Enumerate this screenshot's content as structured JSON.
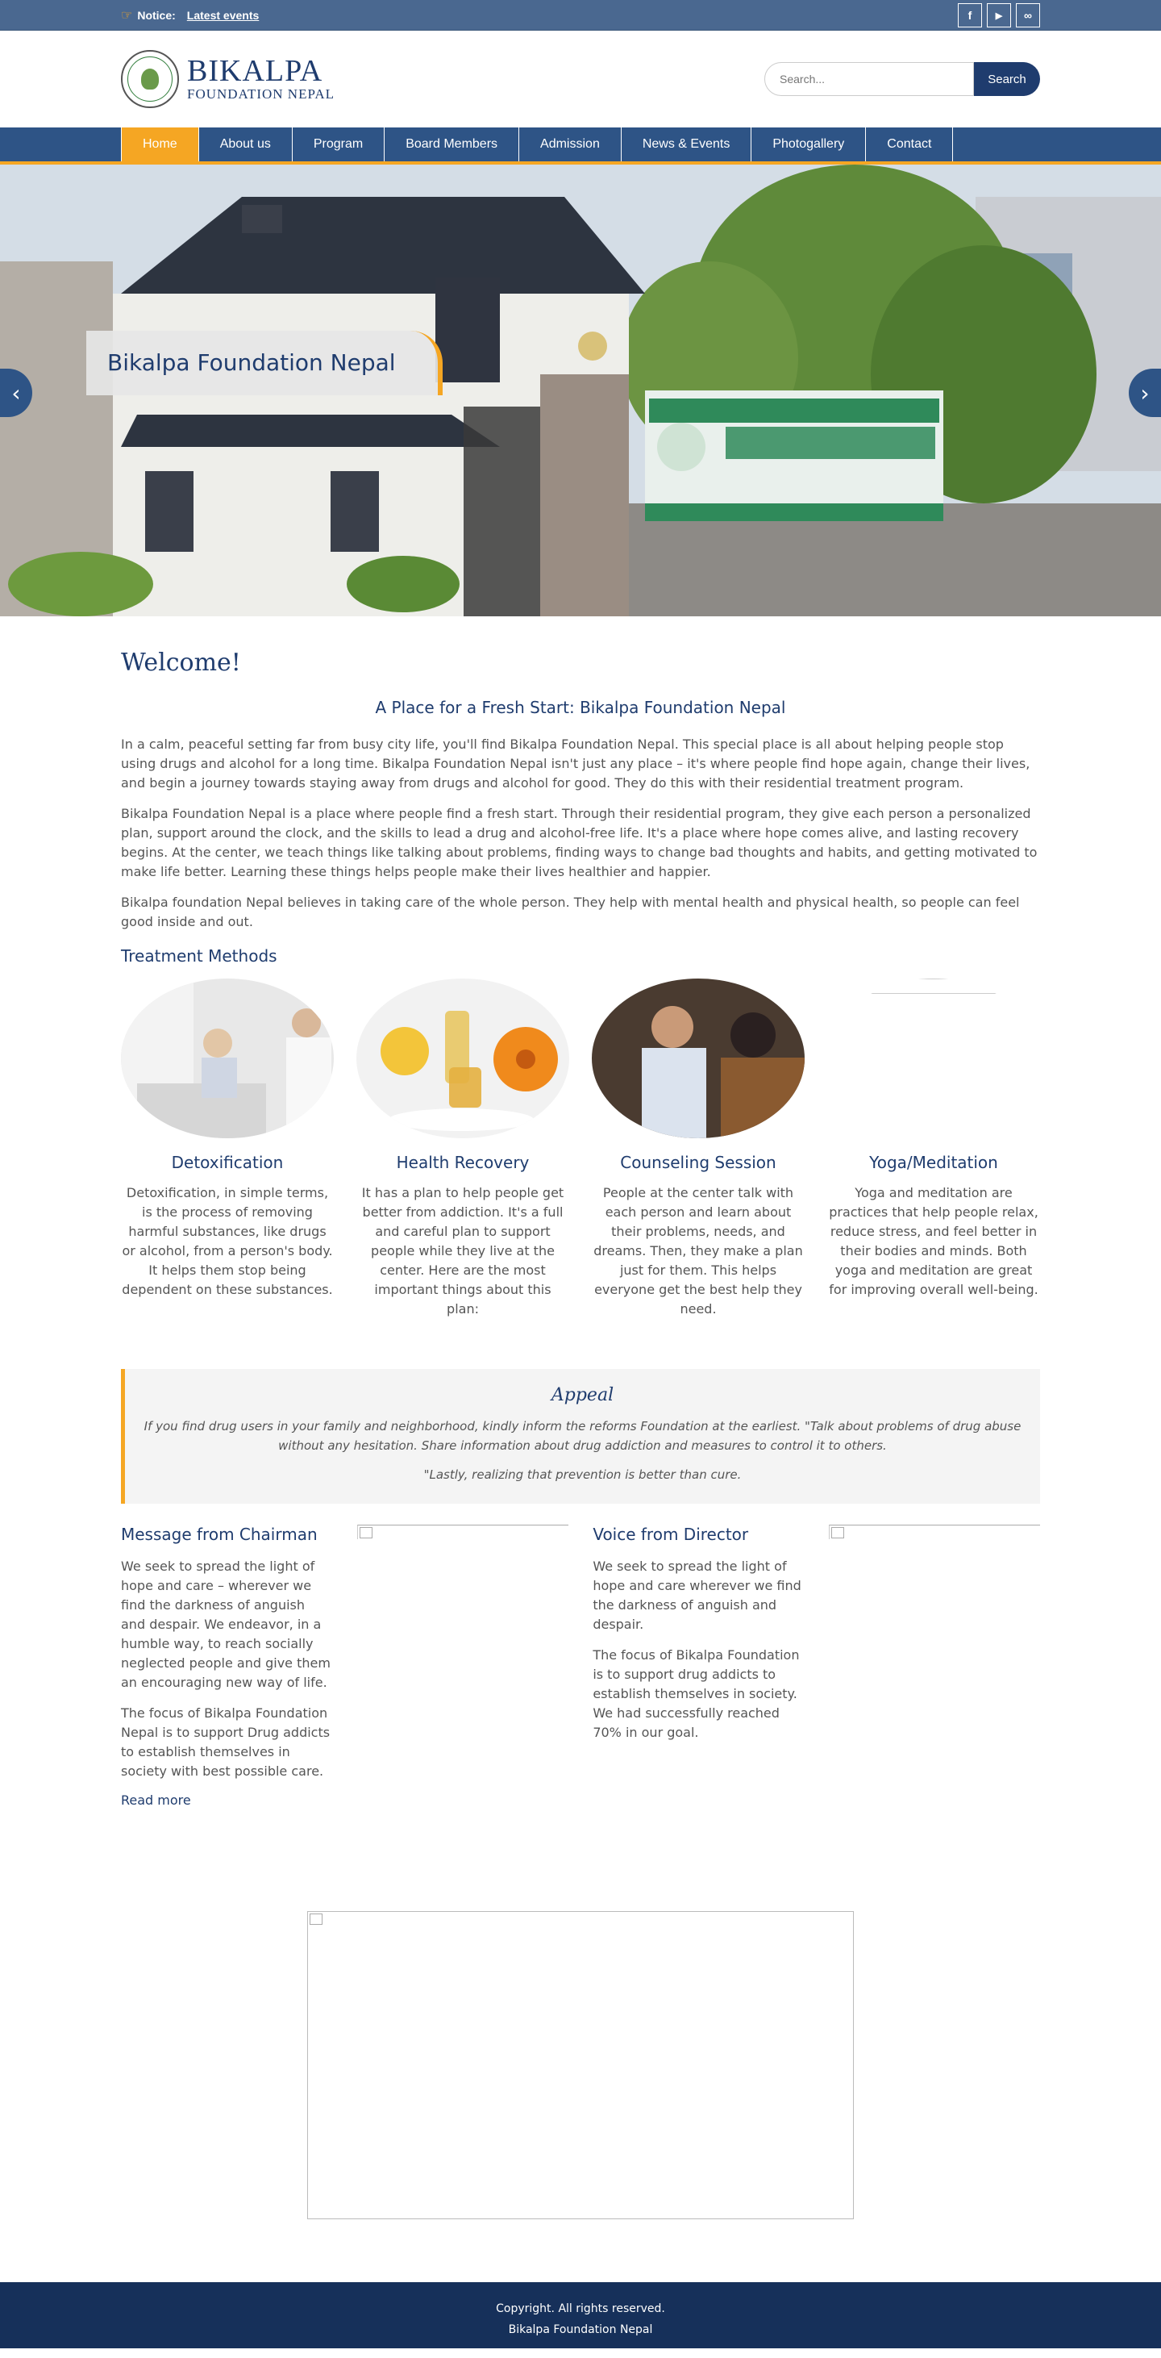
{
  "topbar": {
    "notice_label": "Notice:",
    "notice_link": "Latest events",
    "socials": [
      {
        "icon": "facebook-icon",
        "glyph": "f"
      },
      {
        "icon": "youtube-icon",
        "glyph": "▶"
      },
      {
        "icon": "link-icon",
        "glyph": "∞"
      }
    ]
  },
  "header": {
    "brand_line1": "BIKALPA",
    "brand_line2": "FOUNDATION NEPAL",
    "search_placeholder": "Search...",
    "search_button": "Search"
  },
  "nav": {
    "items": [
      "Home",
      "About us",
      "Program",
      "Board Members",
      "Admission",
      "News & Events",
      "Photogallery",
      "Contact"
    ],
    "active": "Home"
  },
  "hero": {
    "caption": "Bikalpa Foundation Nepal"
  },
  "welcome": {
    "title": "Welcome!",
    "subtitle": "A Place for a Fresh Start: Bikalpa Foundation Nepal",
    "paragraphs": [
      "In a calm, peaceful setting far from busy city life, you'll find Bikalpa Foundation Nepal. This special place is all about helping people stop using drugs and alcohol for a long time. Bikalpa Foundation Nepal isn't just any place – it's where people find hope again, change their lives, and begin a journey towards staying away from drugs and alcohol for good. They do this with their residential treatment program.",
      "Bikalpa Foundation Nepal is a place where people find a fresh start. Through their residential program, they give each person a personalized plan, support around the clock, and the skills to lead a drug and alcohol-free life. It's a place where hope comes alive, and lasting recovery begins. At the center, we teach things like talking about problems, finding ways to change bad thoughts and habits, and getting motivated to make life better. Learning these things helps people make their lives healthier and happier.",
      "Bikalpa foundation Nepal believes in taking care of the whole person. They help with mental health and physical health, so people can feel good inside and out."
    ]
  },
  "treatment": {
    "heading": "Treatment Methods",
    "methods": [
      {
        "title": "Detoxification",
        "text": "Detoxification, in simple terms, is the process of removing harmful substances, like drugs or alcohol, from a person's body. It helps them stop being dependent on these substances."
      },
      {
        "title": "Health Recovery",
        "text": "It has a plan to help people get better from addiction. It's a full and careful plan to support people while they live at the center. Here are the most important things about this plan:"
      },
      {
        "title": "Counseling Session",
        "text": "People at the center talk with each person and learn about their problems, needs, and dreams. Then, they make a plan just for them. This helps everyone get the best help they need."
      },
      {
        "title": "Yoga/Meditation",
        "text": "Yoga and meditation are practices that help people relax, reduce stress, and feel better in their bodies and minds. Both yoga and meditation are great for improving overall well-being."
      }
    ]
  },
  "appeal": {
    "title": "Appeal",
    "text1": "If you find drug users in your family and neighborhood, kindly inform the reforms Foundation at the earliest. \"Talk about problems of drug abuse without any hesitation. Share information about drug addiction and measures to control it to others.",
    "text2": "\"Lastly, realizing that prevention is better than cure."
  },
  "chairman": {
    "title": "Message from Chairman",
    "p1": "We seek to spread the light of hope and care – wherever we find the darkness of anguish and despair. We endeavor, in a humble way, to reach socially neglected people and give them an encouraging new way of life.",
    "p2": "The focus of Bikalpa Foundation Nepal is to support Drug addicts to establish themselves in society with best possible care.",
    "read_more": "Read more"
  },
  "director": {
    "title": "Voice from Director",
    "p1": "We seek to spread the light of hope and care wherever we find the darkness of anguish and despair.",
    "p2": "The focus of Bikalpa Foundation is to support drug addicts to establish themselves in society. We had successfully reached 70% in our goal."
  },
  "footer": {
    "line1": "Copyright. All rights reserved.",
    "line2": "Bikalpa Foundation Nepal"
  }
}
